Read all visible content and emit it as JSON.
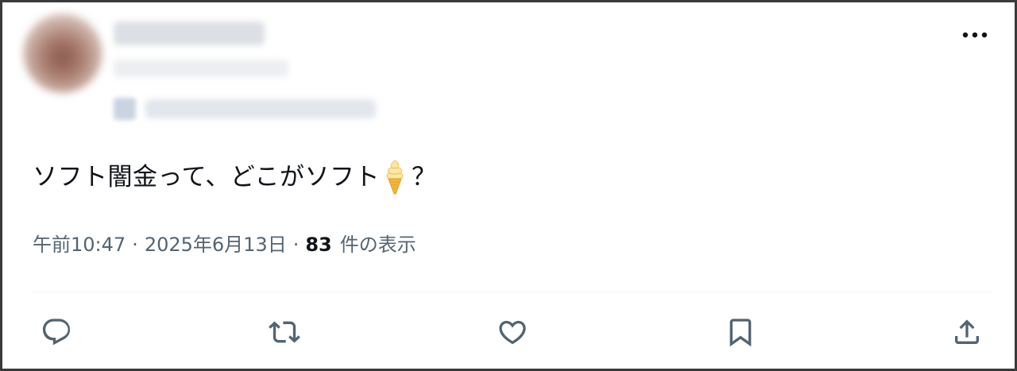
{
  "tweet": {
    "text_before_emoji": "ソフト闇金って、どこがソフト",
    "emoji_icon": "soft-serve-ice-cream-icon",
    "text_after_emoji": "？",
    "time": "午前10:47",
    "separator": "·",
    "date": "2025年6月13日",
    "views_count": "83",
    "views_label": "件の表示"
  },
  "header": {
    "avatar": "blurred-avatar",
    "more_icon": "more-options-icon"
  },
  "actions": [
    {
      "name": "reply",
      "icon": "reply-icon"
    },
    {
      "name": "retweet",
      "icon": "retweet-icon"
    },
    {
      "name": "like",
      "icon": "like-icon"
    },
    {
      "name": "bookmark",
      "icon": "bookmark-icon"
    },
    {
      "name": "share",
      "icon": "share-icon"
    }
  ],
  "colors": {
    "text_primary": "#0f1419",
    "text_secondary": "#536471",
    "divider": "#eff3f4",
    "frame_border": "#3a3a3a"
  }
}
